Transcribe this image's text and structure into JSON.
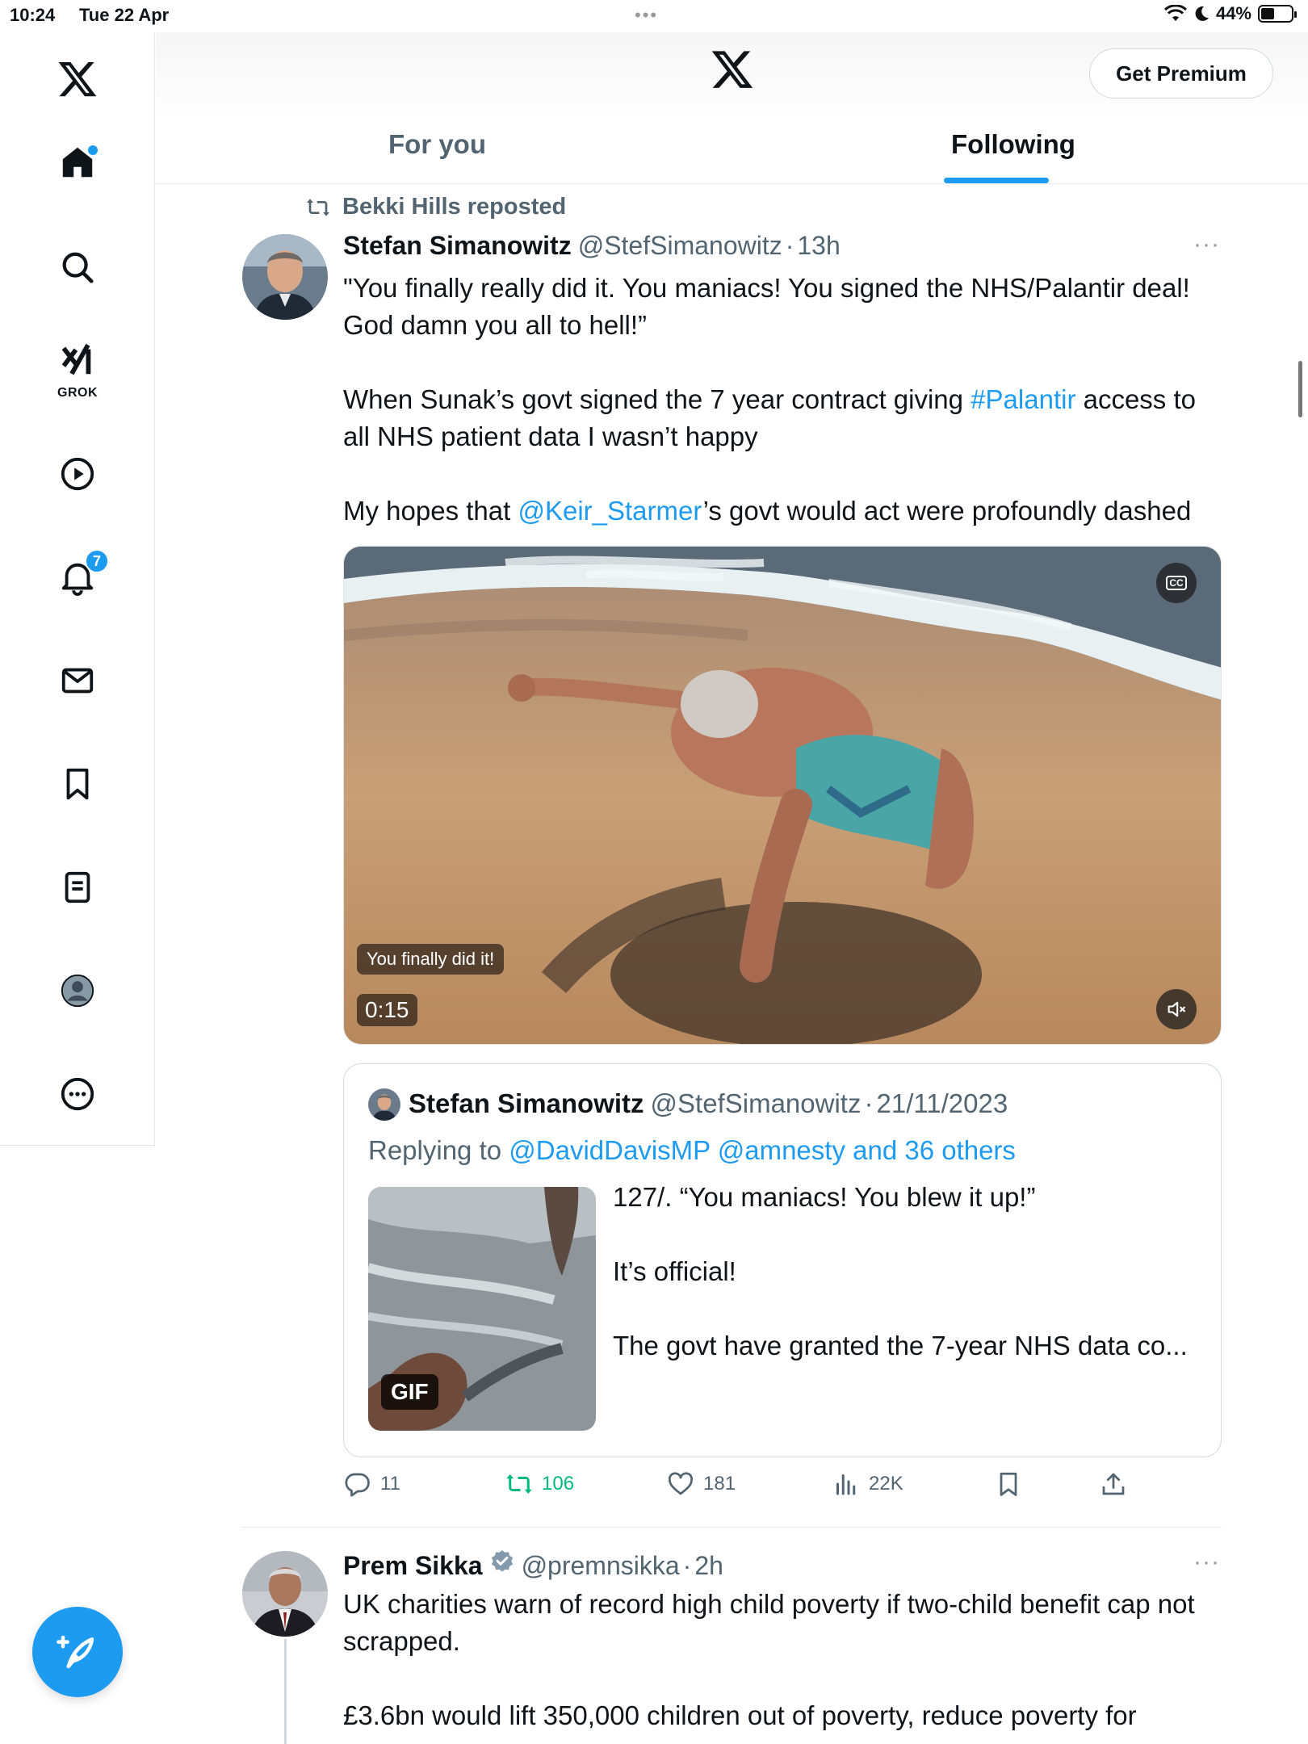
{
  "status_bar": {
    "time": "10:24",
    "date": "Tue 22 Apr",
    "battery": "44%"
  },
  "nav": {
    "grok_label": "GROK",
    "notifications_badge": "7"
  },
  "header": {
    "premium_label": "Get Premium",
    "tabs": [
      {
        "label": "For you",
        "active": false
      },
      {
        "label": "Following",
        "active": true
      }
    ]
  },
  "tweet1": {
    "repost_text": "Bekki Hills reposted",
    "name": "Stefan Simanowitz",
    "handle": "@StefSimanowitz",
    "dot": "·",
    "time": "13h",
    "more": "···",
    "text_p1": "\"You finally really did it. You maniacs! You signed the NHS/Palantir deal! God damn you all to hell!”",
    "text_p2_a": "When Sunak’s govt signed the 7 year contract giving ",
    "text_p2_link": "#Palantir",
    "text_p2_b": " access to all NHS patient data I wasn’t happy",
    "text_p3_a": "My hopes that ",
    "text_p3_link": "@Keir_Starmer",
    "text_p3_b": "’s govt would act were profoundly dashed",
    "video": {
      "caption": "You finally did it!",
      "duration": "0:15",
      "cc": "CC"
    },
    "quote": {
      "name": "Stefan Simanowitz",
      "handle": "@StefSimanowitz",
      "dot": "·",
      "date": "21/11/2023",
      "replying_prefix": "Replying to ",
      "replying_links": "@DavidDavisMP @amnesty and 36 others",
      "gif_label": "GIF",
      "lines": [
        "127/. “You maniacs! You blew it up!”",
        "It’s official!",
        "The govt have granted the 7-year NHS data co..."
      ]
    },
    "stats": {
      "replies": "11",
      "reposts": "106",
      "likes": "181",
      "views": "22K"
    }
  },
  "tweet2": {
    "name": "Prem Sikka",
    "handle": "@premnsikka",
    "dot": "·",
    "time": "2h",
    "more": "···",
    "text_p1": "UK charities warn of record high child poverty if two-child benefit cap not scrapped.",
    "text_p2": "£3.6bn would lift 350,000 children out of poverty, reduce poverty for"
  },
  "colors": {
    "accent": "#1d9bf0",
    "retweet_green": "#00ba7c",
    "secondary_text": "#536471"
  }
}
